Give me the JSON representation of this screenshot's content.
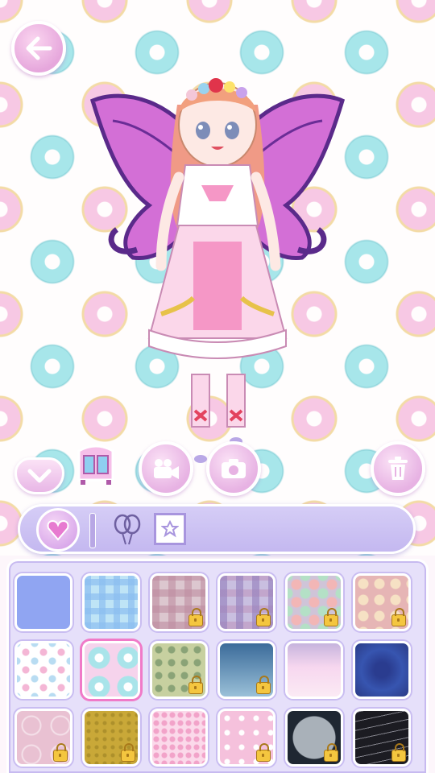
{
  "screen": {
    "accent_color": "#c4b8f0",
    "wallpaper_colors": [
      "#a7e6ea",
      "#f7c8e4",
      "#f3dba6"
    ]
  },
  "toolbar": {
    "back_icon": "arrow-left-icon",
    "collapse_icon": "chevron-down-icon",
    "wardrobe_icon": "wardrobe-icon",
    "video_icon": "video-camera-icon",
    "camera_icon": "camera-icon",
    "trash_icon": "trash-icon"
  },
  "category_tabs": [
    {
      "name": "hair",
      "icon": "heart-gem-icon",
      "active": true
    },
    {
      "name": "accessories",
      "icon": "balloons-icon",
      "active": false
    },
    {
      "name": "background",
      "icon": "star-frame-icon",
      "active": false
    }
  ],
  "backgrounds": [
    {
      "pattern": "solid-blue",
      "locked": false,
      "selected": false
    },
    {
      "pattern": "blue-plaid",
      "locked": false,
      "selected": false
    },
    {
      "pattern": "pink-plaid",
      "locked": true,
      "selected": false
    },
    {
      "pattern": "purple-plaid",
      "locked": true,
      "selected": false
    },
    {
      "pattern": "multicolor-dots",
      "locked": true,
      "selected": false
    },
    {
      "pattern": "red-polka-dots",
      "locked": true,
      "selected": false
    },
    {
      "pattern": "pastel-dots",
      "locked": false,
      "selected": false
    },
    {
      "pattern": "donuts",
      "locked": false,
      "selected": true
    },
    {
      "pattern": "green-hearts",
      "locked": true,
      "selected": false
    },
    {
      "pattern": "blue-gradient",
      "locked": true,
      "selected": false
    },
    {
      "pattern": "pink-clouds",
      "locked": false,
      "selected": false
    },
    {
      "pattern": "magic-circle",
      "locked": false,
      "selected": false
    },
    {
      "pattern": "pink-lace",
      "locked": true,
      "selected": false
    },
    {
      "pattern": "mustard-texture",
      "locked": true,
      "selected": false
    },
    {
      "pattern": "pink-hearts",
      "locked": false,
      "selected": false
    },
    {
      "pattern": "pink-bows",
      "locked": true,
      "selected": false
    },
    {
      "pattern": "moon-night",
      "locked": true,
      "selected": false
    },
    {
      "pattern": "dark-lines",
      "locked": true,
      "selected": false
    }
  ]
}
